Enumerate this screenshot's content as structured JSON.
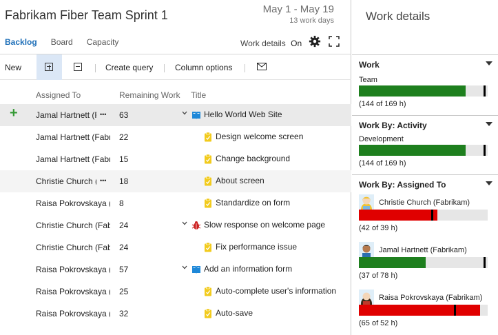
{
  "header": {
    "sprint_title": "Fabrikam Fiber Team Sprint 1",
    "dates": "May 1 - May 19",
    "work_days": "13 work days"
  },
  "tabs": [
    {
      "label": "Backlog",
      "active": true
    },
    {
      "label": "Board",
      "active": false
    },
    {
      "label": "Capacity",
      "active": false
    }
  ],
  "work_details_toggle": {
    "label": "Work details",
    "state": "On"
  },
  "toolbar": {
    "new_label": "New",
    "create_query_label": "Create query",
    "column_options_label": "Column options"
  },
  "columns": {
    "assigned_to": "Assigned To",
    "remaining_work": "Remaining Work",
    "title": "Title"
  },
  "rows": [
    {
      "assigned": "Jamal Hartnett (Fabrikam)",
      "remaining": "63",
      "title": "Hello World Web Site",
      "type": "story",
      "level": 0,
      "expandable": true,
      "state": "selected"
    },
    {
      "assigned": "Jamal Hartnett (Fabrikam)",
      "remaining": "22",
      "title": "Design welcome screen",
      "type": "task",
      "level": 1,
      "expandable": false,
      "state": ""
    },
    {
      "assigned": "Jamal Hartnett (Fabrikam)",
      "remaining": "15",
      "title": "Change background",
      "type": "task",
      "level": 1,
      "expandable": false,
      "state": ""
    },
    {
      "assigned": "Christie Church (Fabrikam)",
      "remaining": "18",
      "title": "About screen",
      "type": "task",
      "level": 1,
      "expandable": false,
      "state": "hover"
    },
    {
      "assigned": "Raisa Pokrovskaya (Fabrikam)",
      "remaining": "8",
      "title": "Standardize on form",
      "type": "task",
      "level": 1,
      "expandable": false,
      "state": ""
    },
    {
      "assigned": "Christie Church (Fabrikam)",
      "remaining": "24",
      "title": "Slow response on welcome page",
      "type": "bug",
      "level": 0,
      "expandable": true,
      "state": ""
    },
    {
      "assigned": "Christie Church (Fabrikam)",
      "remaining": "24",
      "title": "Fix performance issue",
      "type": "task",
      "level": 1,
      "expandable": false,
      "state": ""
    },
    {
      "assigned": "Raisa Pokrovskaya (Fabrikam)",
      "remaining": "57",
      "title": "Add an information form",
      "type": "story",
      "level": 0,
      "expandable": true,
      "state": ""
    },
    {
      "assigned": "Raisa Pokrovskaya (Fabrikam)",
      "remaining": "25",
      "title": "Auto-complete user's information",
      "type": "task",
      "level": 1,
      "expandable": false,
      "state": ""
    },
    {
      "assigned": "Raisa Pokrovskaya (Fabrikam)",
      "remaining": "32",
      "title": "Auto-save",
      "type": "task",
      "level": 1,
      "expandable": false,
      "state": ""
    }
  ],
  "work_details": {
    "title": "Work details",
    "work": {
      "heading": "Work",
      "label": "Team",
      "note": "(144 of 169 h)",
      "fill": 0.83,
      "marker": 0.97,
      "color": "#1e7f1e"
    },
    "by_activity": {
      "heading": "Work By: Activity",
      "label": "Development",
      "note": "(144 of 169 h)",
      "fill": 0.83,
      "marker": 0.97,
      "color": "#1e7f1e"
    },
    "by_assigned": {
      "heading": "Work By: Assigned To",
      "people": [
        {
          "name": "Christie Church (Fabrikam)",
          "note": "(42 of 39 h)",
          "fill": 0.61,
          "marker": 0.56,
          "color": "#e00000",
          "avatar": "christie-avatar"
        },
        {
          "name": "Jamal Hartnett (Fabrikam)",
          "note": "(37 of 78 h)",
          "fill": 0.52,
          "marker": 0.97,
          "color": "#1e7f1e",
          "avatar": "jamal-avatar"
        },
        {
          "name": "Raisa Pokrovskaya (Fabrikam)",
          "note": "(65 of 52 h)",
          "fill": 0.94,
          "marker": 0.74,
          "color": "#e00000",
          "avatar": "raisa-avatar"
        }
      ]
    }
  }
}
